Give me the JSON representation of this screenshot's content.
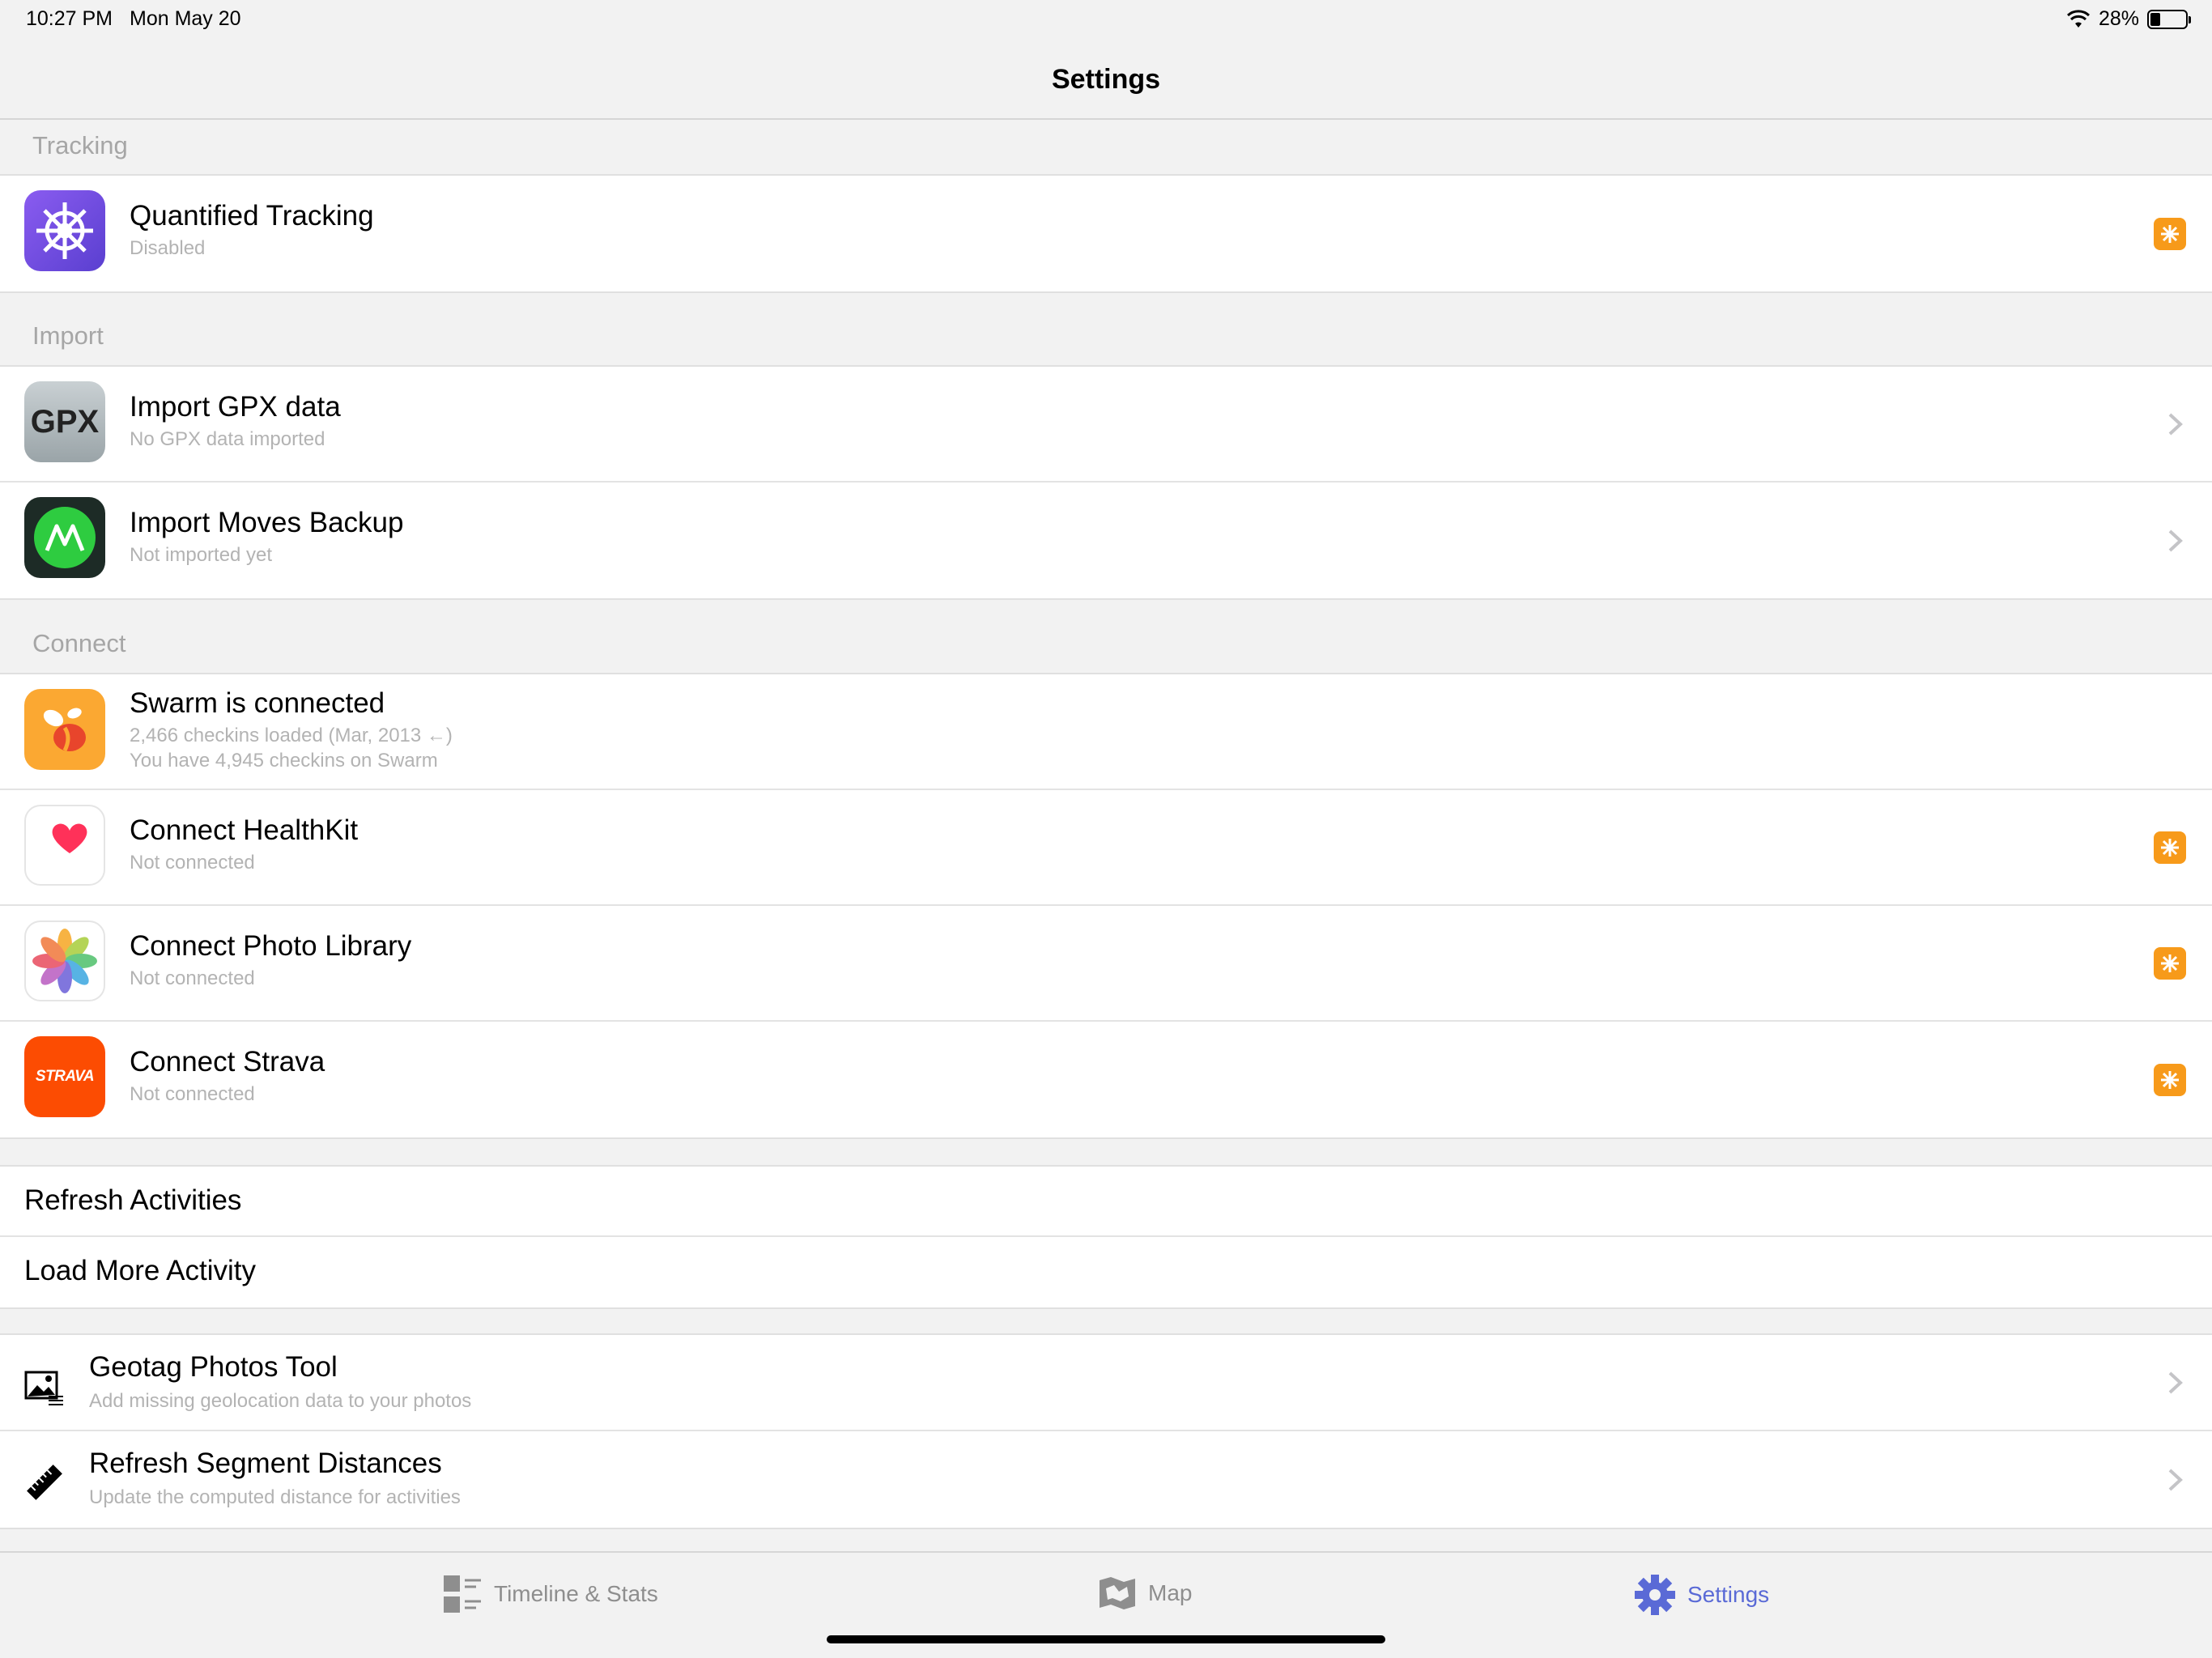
{
  "status_bar": {
    "time": "10:27 PM",
    "date": "Mon May 20",
    "battery": "28%",
    "battery_level": 0.28
  },
  "nav": {
    "title": "Settings"
  },
  "sections": {
    "tracking": {
      "header": "Tracking",
      "rows": [
        {
          "title": "Quantified Tracking",
          "subtitle": "Disabled",
          "icon": "ship-wheel-icon",
          "accessory": "badge"
        }
      ]
    },
    "import": {
      "header": "Import",
      "rows": [
        {
          "title": "Import GPX data",
          "subtitle": "No GPX data imported",
          "icon": "gpx-icon",
          "icon_text": "GPX",
          "accessory": "chevron"
        },
        {
          "title": "Import Moves Backup",
          "subtitle": "Not imported yet",
          "icon": "moves-icon",
          "accessory": "chevron"
        }
      ]
    },
    "connect": {
      "header": "Connect",
      "rows": [
        {
          "title": "Swarm is connected",
          "subtitle": "2,466 checkins loaded (Mar, 2013 ←)",
          "subtitle2": "You have 4,945 checkins on Swarm",
          "icon": "swarm-icon"
        },
        {
          "title": "Connect HealthKit",
          "subtitle": "Not connected",
          "icon": "healthkit-icon",
          "accessory": "badge"
        },
        {
          "title": "Connect Photo Library",
          "subtitle": "Not connected",
          "icon": "photos-icon",
          "accessory": "badge"
        },
        {
          "title": "Connect Strava",
          "subtitle": "Not connected",
          "icon": "strava-icon",
          "icon_text": "STRAVA",
          "accessory": "badge"
        }
      ]
    },
    "actions": {
      "rows": [
        {
          "label": "Refresh Activities"
        },
        {
          "label": "Load More Activity"
        }
      ]
    },
    "tools": {
      "rows": [
        {
          "title": "Geotag Photos Tool",
          "subtitle": "Add missing geolocation data to your photos",
          "icon": "geotag-photo-icon"
        },
        {
          "title": "Refresh Segment Distances",
          "subtitle": "Update the computed distance for activities",
          "icon": "ruler-icon"
        }
      ]
    }
  },
  "tab_bar": {
    "tabs": [
      {
        "label": "Timeline & Stats",
        "icon": "timeline-icon",
        "active": false
      },
      {
        "label": "Map",
        "icon": "map-icon",
        "active": false
      },
      {
        "label": "Settings",
        "icon": "gear-icon",
        "active": true
      }
    ]
  },
  "colors": {
    "accent": "#5a6ad6",
    "badge": "#f79a1a",
    "swarm": "#fba832",
    "strava": "#fc4c02",
    "moves": "#2ecc40"
  }
}
